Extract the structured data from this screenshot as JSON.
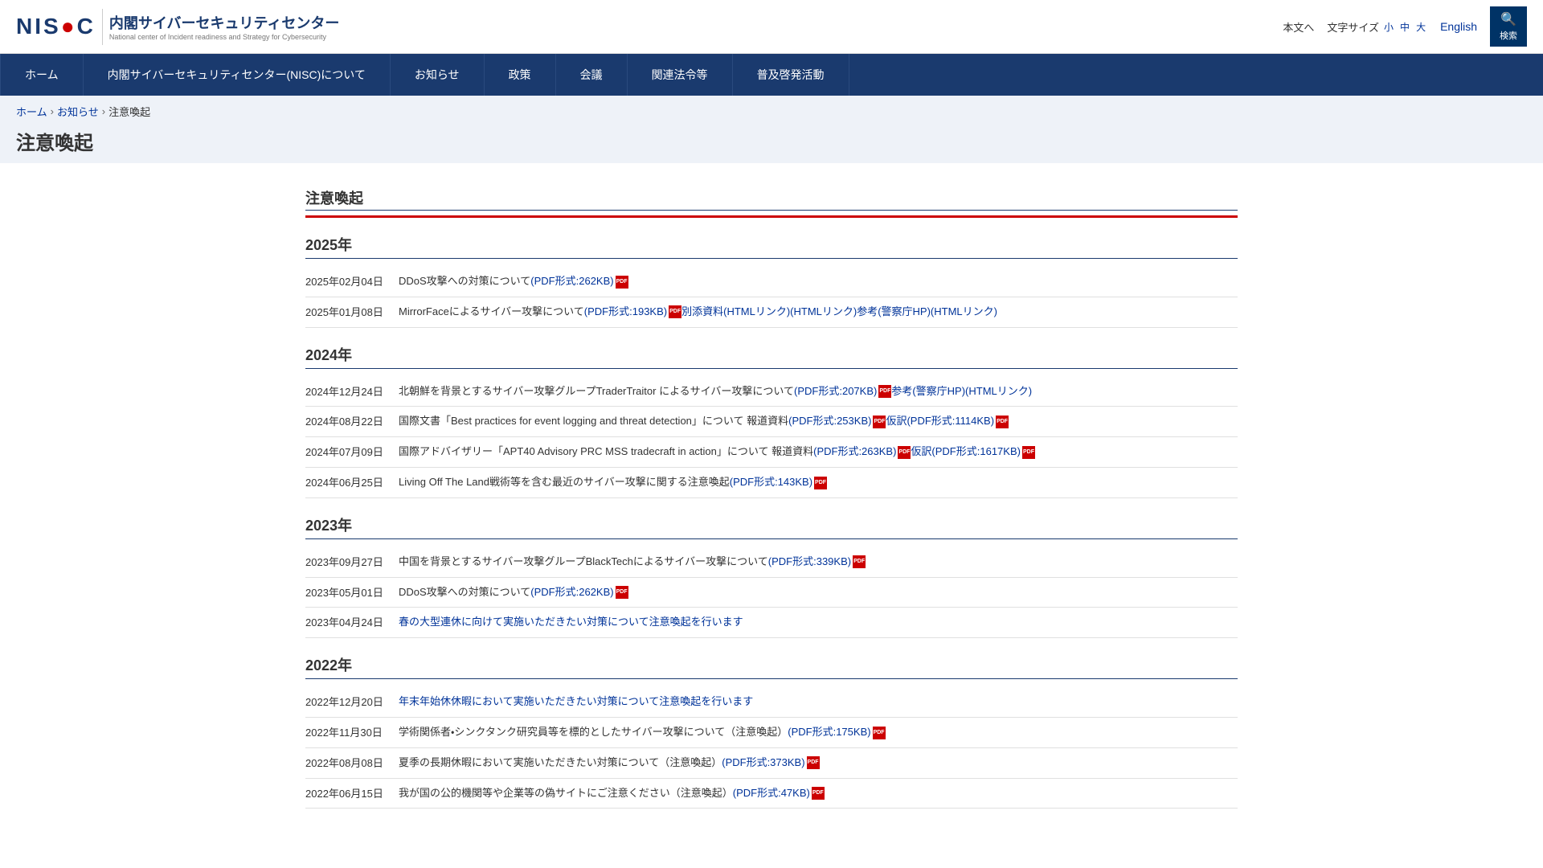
{
  "header": {
    "nisc_label": "NISC",
    "logo_title": "内閣サイバーセキュリティセンター",
    "logo_subtitle": "National center of Incident readiness and Strategy for Cybersecurity",
    "main_text_link": "本文へ",
    "font_size_label": "文字サイズ",
    "font_small": "小",
    "font_medium": "中",
    "font_large": "大",
    "english_label": "English",
    "search_label": "検索"
  },
  "nav": {
    "items": [
      {
        "label": "ホーム",
        "href": "#"
      },
      {
        "label": "内閣サイバーセキュリティセンター(NISC)について",
        "href": "#"
      },
      {
        "label": "お知らせ",
        "href": "#"
      },
      {
        "label": "政策",
        "href": "#"
      },
      {
        "label": "会議",
        "href": "#"
      },
      {
        "label": "関連法令等",
        "href": "#"
      },
      {
        "label": "普及啓発活動",
        "href": "#"
      }
    ]
  },
  "breadcrumb": {
    "home": "ホーム",
    "news": "お知らせ",
    "current": "注意喚起"
  },
  "page_title": "注意喚起",
  "section_heading": "注意喚起",
  "years": [
    {
      "year": "2025年",
      "entries": [
        {
          "date": "2025年02月04日",
          "text": "DDoS攻撃への対策について",
          "links": [
            {
              "label": "(PDF形式:262KB)",
              "href": "#",
              "pdf": true
            }
          ]
        },
        {
          "date": "2025年01月08日",
          "text": "MirrorFaceによるサイバー攻撃について",
          "links": [
            {
              "label": "(PDF形式:193KB)",
              "href": "#",
              "pdf": true
            },
            {
              "label": "別添資料(HTMLリンク)",
              "href": "#",
              "pdf": false
            },
            {
              "label": "(HTMLリンク)",
              "href": "#",
              "pdf": false
            },
            {
              "label": "参考(警察庁HP)(HTMLリンク)",
              "href": "#",
              "pdf": false
            }
          ]
        }
      ]
    },
    {
      "year": "2024年",
      "entries": [
        {
          "date": "2024年12月24日",
          "text": "北朝鮮を背景とするサイバー攻撃グループTraderTraitor によるサイバー攻撃について",
          "links": [
            {
              "label": "(PDF形式:207KB)",
              "href": "#",
              "pdf": true
            },
            {
              "label": "参考(警察庁HP)(HTMLリンク)",
              "href": "#",
              "pdf": false
            }
          ]
        },
        {
          "date": "2024年08月22日",
          "text": "国際文書「Best practices for event logging and threat detection」について 報道資料",
          "links": [
            {
              "label": "(PDF形式:253KB)",
              "href": "#",
              "pdf": true
            },
            {
              "label": "仮訳(PDF形式:1114KB)",
              "href": "#",
              "pdf": true
            }
          ]
        },
        {
          "date": "2024年07月09日",
          "text": "国際アドバイザリー「APT40 Advisory PRC MSS tradecraft in action」について 報道資料",
          "links": [
            {
              "label": "(PDF形式:263KB)",
              "href": "#",
              "pdf": true
            },
            {
              "label": "仮訳(PDF形式:1617KB)",
              "href": "#",
              "pdf": true
            }
          ]
        },
        {
          "date": "2024年06月25日",
          "text": "Living Off The Land戦術等を含む最近のサイバー攻撃に関する注意喚起",
          "links": [
            {
              "label": "(PDF形式:143KB)",
              "href": "#",
              "pdf": true
            }
          ]
        }
      ]
    },
    {
      "year": "2023年",
      "entries": [
        {
          "date": "2023年09月27日",
          "text": "中国を背景とするサイバー攻撃グループBlackTechによるサイバー攻撃について",
          "links": [
            {
              "label": "(PDF形式:339KB)",
              "href": "#",
              "pdf": true
            }
          ]
        },
        {
          "date": "2023年05月01日",
          "text": "DDoS攻撃への対策について",
          "links": [
            {
              "label": "(PDF形式:262KB)",
              "href": "#",
              "pdf": true
            }
          ]
        },
        {
          "date": "2023年04月24日",
          "text": "春の大型連休に向けて実施いただきたい対策について注意喚起を行います",
          "links": [],
          "text_link": true
        }
      ]
    },
    {
      "year": "2022年",
      "entries": [
        {
          "date": "2022年12月20日",
          "text": "年末年始休休暇において実施いただきたい対策について注意喚起を行います",
          "links": [],
          "text_link": true
        },
        {
          "date": "2022年11月30日",
          "text": "学術関係者・シンクタンク研究員等を標的としたサイバー攻撃について（注意喚起）",
          "links": [
            {
              "label": "(PDF形式:175KB)",
              "href": "#",
              "pdf": true
            }
          ]
        },
        {
          "date": "2022年08月08日",
          "text": "夏季の長期休暇において実施いただきたい対策について（注意喚起）",
          "links": [
            {
              "label": "(PDF形式:373KB)",
              "href": "#",
              "pdf": true
            }
          ]
        },
        {
          "date": "2022年06月15日",
          "text": "我が国の公的機関等や企業等の偽サイトにご注意ください（注意喚起）",
          "links": [
            {
              "label": "(PDF形式:47KB)",
              "href": "#",
              "pdf": true
            }
          ]
        }
      ]
    }
  ]
}
